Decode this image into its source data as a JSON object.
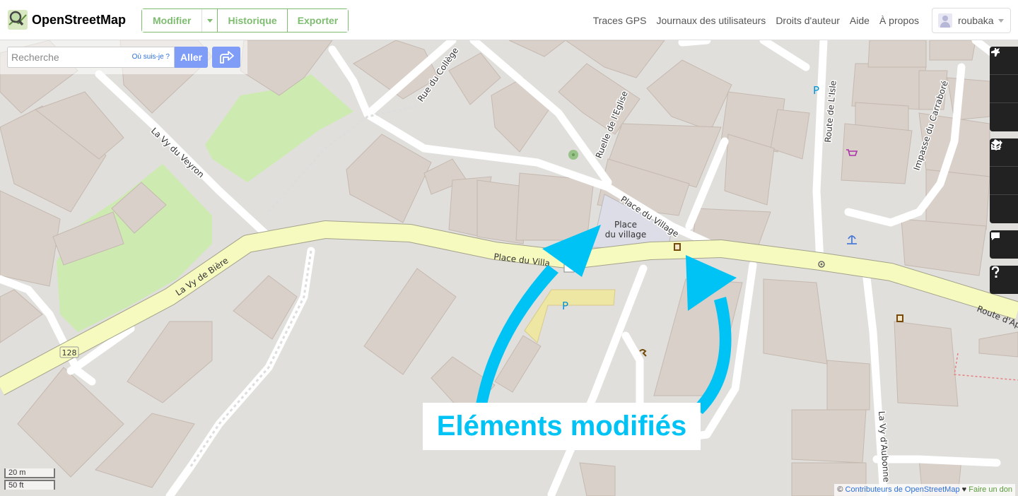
{
  "header": {
    "brand": "OpenStreetMap",
    "edit_buttons": {
      "edit": "Modifier",
      "history": "Historique",
      "export": "Exporter"
    },
    "nav": [
      "Traces GPS",
      "Journaux des utilisateurs",
      "Droits d'auteur",
      "Aide",
      "À propos"
    ],
    "user": {
      "name": "roubaka"
    }
  },
  "search": {
    "placeholder": "Recherche",
    "where_am_i": "Où suis-je ?",
    "go": "Aller"
  },
  "controls": [
    "zoom-in-icon",
    "zoom-out-icon",
    "locate-icon",
    "layers-icon",
    "info-icon",
    "share-icon",
    "note-icon",
    "help-icon"
  ],
  "map": {
    "streets": {
      "vy_de_biere": "La Vy de Bière",
      "vy_du_veyron": "La Vy du Veyron",
      "rue_du_college": "Rue du Collège",
      "ruelle_eglise": "Ruelle de l'Eglise",
      "place_du_village": "Place du Village",
      "place_du_village_main": "Place du Villa",
      "route_isle": "Route de L'Isle",
      "impasse_carrabore": "Impasse du Carraboré",
      "route_apples": "Route d'Ap",
      "vy_aubonne": "La Vy d'Aubonne"
    },
    "square_label_line1": "Place",
    "square_label_line2": "du village",
    "route_shield": "128",
    "parking_label": "P",
    "annotation": "Eléments modifiés",
    "colors": {
      "arrow": "#00c3f5",
      "road_primary": "#f7fabf",
      "park": "#cdebb0",
      "building": "#d9d0c9",
      "pedestrian": "#dddde8"
    }
  },
  "scale": {
    "metric": "20 m",
    "imperial": "50 ft"
  },
  "attribution": {
    "copy": "©",
    "contributors": "Contributeurs de OpenStreetMap",
    "heart": "♥",
    "donate": "Faire un don"
  }
}
